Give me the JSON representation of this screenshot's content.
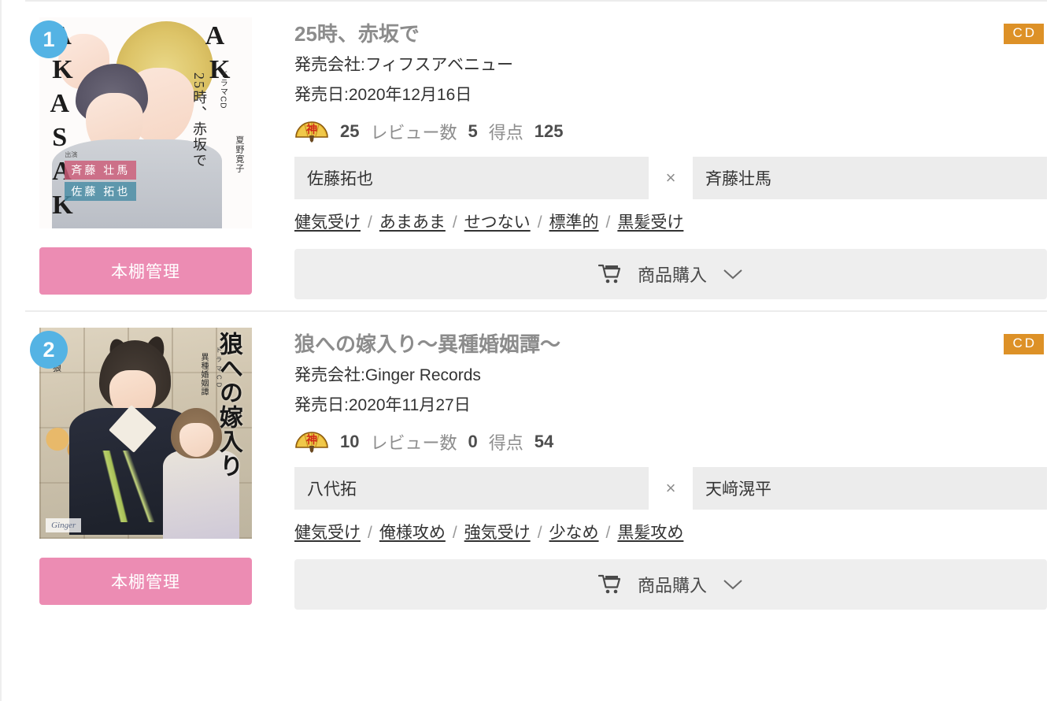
{
  "list": {
    "items": [
      {
        "rank": "1",
        "media_badge": "CD",
        "title": "25時、赤坂で",
        "publisher_line": "発売会社:フィフスアベニュー",
        "release_line": "発売日:2020年12月16日",
        "rating_icon": "kami-fan-icon",
        "rating_value": "25",
        "review_label": "レビュー数",
        "review_count": "5",
        "score_label": "得点",
        "score_value": "125",
        "cast_left": "佐藤拓也",
        "cast_separator": "×",
        "cast_right": "斉藤壮馬",
        "tags": [
          "健気受け",
          "あまあま",
          "せつない",
          "標準的",
          "黒髪受け"
        ],
        "tag_separator": "/",
        "shelf_button": "本棚管理",
        "buy_button": "商品購入",
        "cover": {
          "vertical_title": "25時、赤坂で",
          "vertical_small": "ドラマCD",
          "vertical_author": "夏野寛子",
          "cast_label": "出演",
          "cast_name_1": "斉藤 壮馬",
          "cast_name_2": "佐藤 拓也"
        }
      },
      {
        "rank": "2",
        "media_badge": "CD",
        "title": "狼への嫁入り〜異種婚姻譚〜",
        "publisher_line": "発売会社:Ginger Records",
        "release_line": "発売日:2020年11月27日",
        "rating_icon": "kami-fan-icon",
        "rating_value": "10",
        "review_label": "レビュー数",
        "review_count": "0",
        "score_label": "得点",
        "score_value": "54",
        "cast_left": "八代拓",
        "cast_separator": "×",
        "cast_right": "天﨑滉平",
        "tags": [
          "健気受け",
          "俺様攻め",
          "強気受け",
          "少なめ",
          "黒髪攻め"
        ],
        "tag_separator": "/",
        "shelf_button": "本棚管理",
        "buy_button": "商品購入",
        "cover": {
          "vertical_title": "狼への嫁入り",
          "vertical_sub": "異種婚姻譚",
          "vertical_small": "ドラマCD",
          "vertical_left": "大狼",
          "label": "Ginger"
        }
      }
    ]
  },
  "colors": {
    "rank_badge": "#54b3e4",
    "shelf_button": "#ec8cb3",
    "media_badge": "#dd9127",
    "title": "#8c8c8c",
    "buy_button": "#eeeeee",
    "cast_box": "#ececec",
    "divider": "#ececec"
  },
  "icons": {
    "cart": "cart-icon",
    "chevron_down": "chevron-down-icon",
    "fan": "kami-fan-icon"
  }
}
